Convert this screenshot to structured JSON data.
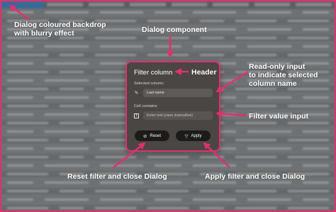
{
  "callouts": {
    "backdrop": [
      "Dialog coloured backdrop",
      "with blurry effect"
    ],
    "dialog_component": "Dialog component",
    "header": "Header",
    "readonly_input": [
      "Read-only input",
      "to indicate selected",
      "column name"
    ],
    "filter_value": "Filter value input",
    "reset": "Reset filter and close Dialog",
    "apply": "Apply filter and close Dialog"
  },
  "dialog": {
    "title": "Filter column",
    "selected_label": "Selected column:",
    "selected_value": "Last name",
    "contains_label": "Cell contains:",
    "contains_placeholder": "Enter text (case insensitive)",
    "reset_label": "Reset",
    "apply_label": "Apply"
  },
  "icons": {
    "selected": "column-select-icon",
    "contains": "text-field-icon",
    "reset": "filter-off-icon",
    "apply": "filter-icon"
  },
  "colors": {
    "accent": "#e0306e",
    "dialog_bg": "#4a4644",
    "button_bg": "#1c1b1a"
  }
}
